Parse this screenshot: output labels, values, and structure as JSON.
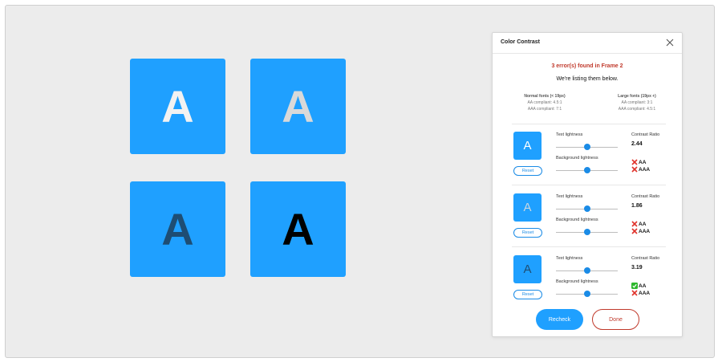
{
  "canvas": {
    "tiles": [
      {
        "letter": "A",
        "bg": "#1fa0ff",
        "fg": "#f2f2f2"
      },
      {
        "letter": "A",
        "bg": "#1fa0ff",
        "fg": "#d9d9d9"
      },
      {
        "letter": "A",
        "bg": "#1fa0ff",
        "fg": "#1e4d73"
      },
      {
        "letter": "A",
        "bg": "#1fa0ff",
        "fg": "#000000"
      }
    ]
  },
  "panel": {
    "title": "Color Contrast",
    "close_icon": "close-icon",
    "error_message": "3 error(s) found in Frame 2",
    "sub_message": "We're listing them below.",
    "criteria": {
      "normal": {
        "heading": "Normal fonts (< 19px)",
        "aa": "AA compliant: 4.5:1",
        "aaa": "AAA compliant: 7:1"
      },
      "large": {
        "heading": "Large fonts (19px +)",
        "aa": "AA compliant: 3:1",
        "aaa": "AAA compliant: 4.5:1"
      }
    },
    "labels": {
      "text_lightness": "Text lightness",
      "background_lightness": "Background lightness",
      "contrast_ratio": "Contrast Ratio",
      "reset": "Reset",
      "aa": "AA",
      "aaa": "AAA"
    },
    "issues": [
      {
        "letter": "A",
        "fg": "#ffffff",
        "text_lightness": 0.5,
        "background_lightness": 0.5,
        "ratio": "2.44",
        "aa_pass": false,
        "aaa_pass": false
      },
      {
        "letter": "A",
        "fg": "#c9d6e0",
        "text_lightness": 0.5,
        "background_lightness": 0.5,
        "ratio": "1.86",
        "aa_pass": false,
        "aaa_pass": false
      },
      {
        "letter": "A",
        "fg": "#1e4d73",
        "text_lightness": 0.5,
        "background_lightness": 0.5,
        "ratio": "3.19",
        "aa_pass": true,
        "aaa_pass": false
      }
    ],
    "recheck_label": "Recheck",
    "done_label": "Done",
    "colors": {
      "accent": "#1fa0ff",
      "error": "#c0392b",
      "pass": "#2eb82e",
      "fail": "#e0322b"
    }
  }
}
